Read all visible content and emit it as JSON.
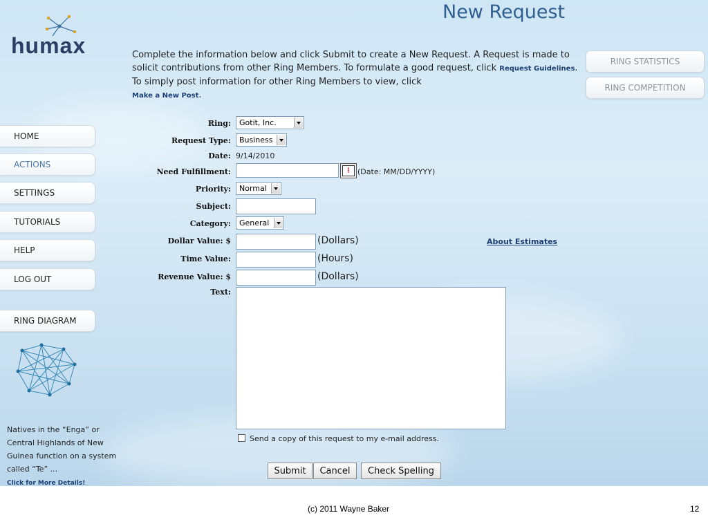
{
  "header": {
    "title": "New Request",
    "logo_text": "humax"
  },
  "intro": {
    "text_1": "Complete the information below and click Submit to create a New Request. A Request is made to solicit contributions from other Ring Members. To formulate a good request, click ",
    "guidelines_link": "Request Guidelines",
    "text_2": ". To simply post information for other Ring Members to view, click",
    "post_link": "Make a New Post",
    "text_3": "."
  },
  "right_buttons": {
    "stats": "RING STATISTICS",
    "competition": "RING COMPETITION"
  },
  "nav": {
    "home": "HOME",
    "actions": "ACTIONS",
    "settings": "SETTINGS",
    "tutorials": "TUTORIALS",
    "help": "HELP",
    "logout": "LOG OUT",
    "ring_diagram": "RING DIAGRAM"
  },
  "sidebar": {
    "blurb": "Natives in the “Enga” or Central Highlands of New Guinea function on a system called “Te” ...",
    "more_link": "Click for More Details!"
  },
  "form": {
    "ring_label": "Ring:",
    "ring_value": "Gotit, Inc.",
    "type_label": "Request Type:",
    "type_value": "Business",
    "date_label": "Date:",
    "date_value": "9/14/2010",
    "need_label": "Need Fulfillment:",
    "need_value": "",
    "need_hint": "(Date: MM/DD/YYYY)",
    "priority_label": "Priority:",
    "priority_value": "Normal",
    "subject_label": "Subject:",
    "subject_value": "",
    "category_label": "Category:",
    "category_value": "General",
    "dollar_label": "Dollar Value: $",
    "dollar_unit": "(Dollars)",
    "time_label": "Time Value:",
    "time_unit": "(Hours)",
    "revenue_label": "Revenue Value: $",
    "revenue_unit": "(Dollars)",
    "estimates_link": "About Estimates",
    "text_label": "Text:",
    "copy_label": "Send a copy of this request to my e-mail address.",
    "copy_checked": false
  },
  "buttons": {
    "submit": "Submit",
    "cancel": "Cancel",
    "spell": "Check Spelling"
  },
  "footer": {
    "copyright": "(c) 2011 Wayne Baker",
    "page_number": "12"
  }
}
